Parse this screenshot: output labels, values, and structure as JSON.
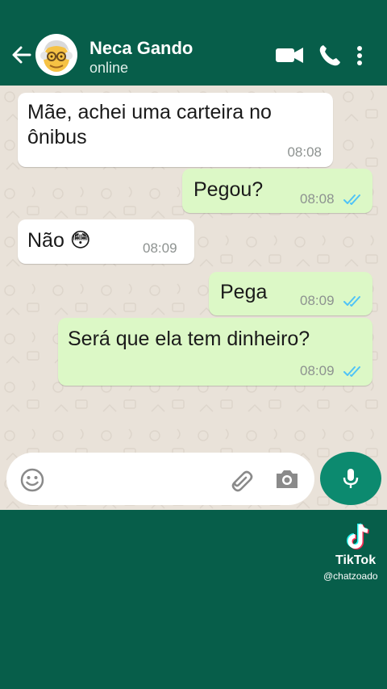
{
  "header": {
    "contact_name": "Neca Gando",
    "status": "online",
    "icons": [
      "back-arrow-icon",
      "video-call-icon",
      "phone-icon",
      "more-vert-icon"
    ]
  },
  "messages": [
    {
      "direction": "incoming",
      "text_line1": "Mãe, achei uma carteira no",
      "text_line2": "ônibus",
      "time": "08:08"
    },
    {
      "direction": "outgoing",
      "text": "Pegou?",
      "time": "08:08",
      "read": true
    },
    {
      "direction": "incoming",
      "text": "Não 😳",
      "time": "08:09"
    },
    {
      "direction": "outgoing",
      "text": "Pega",
      "time": "08:09",
      "read": true
    },
    {
      "direction": "outgoing",
      "text": "Será que ela tem dinheiro?",
      "time": "08:09",
      "read": true
    }
  ],
  "composer": {
    "icons": [
      "emoji-icon",
      "attach-icon",
      "camera-icon",
      "mic-icon"
    ]
  },
  "watermark": {
    "brand": "TikTok",
    "handle": "@chatzoado"
  },
  "colors": {
    "header": "#075e4a",
    "incoming_bubble": "#ffffff",
    "outgoing_bubble": "#dcf8c6",
    "read_ticks": "#4fc3f7",
    "mic_button": "#0c8a6f"
  }
}
